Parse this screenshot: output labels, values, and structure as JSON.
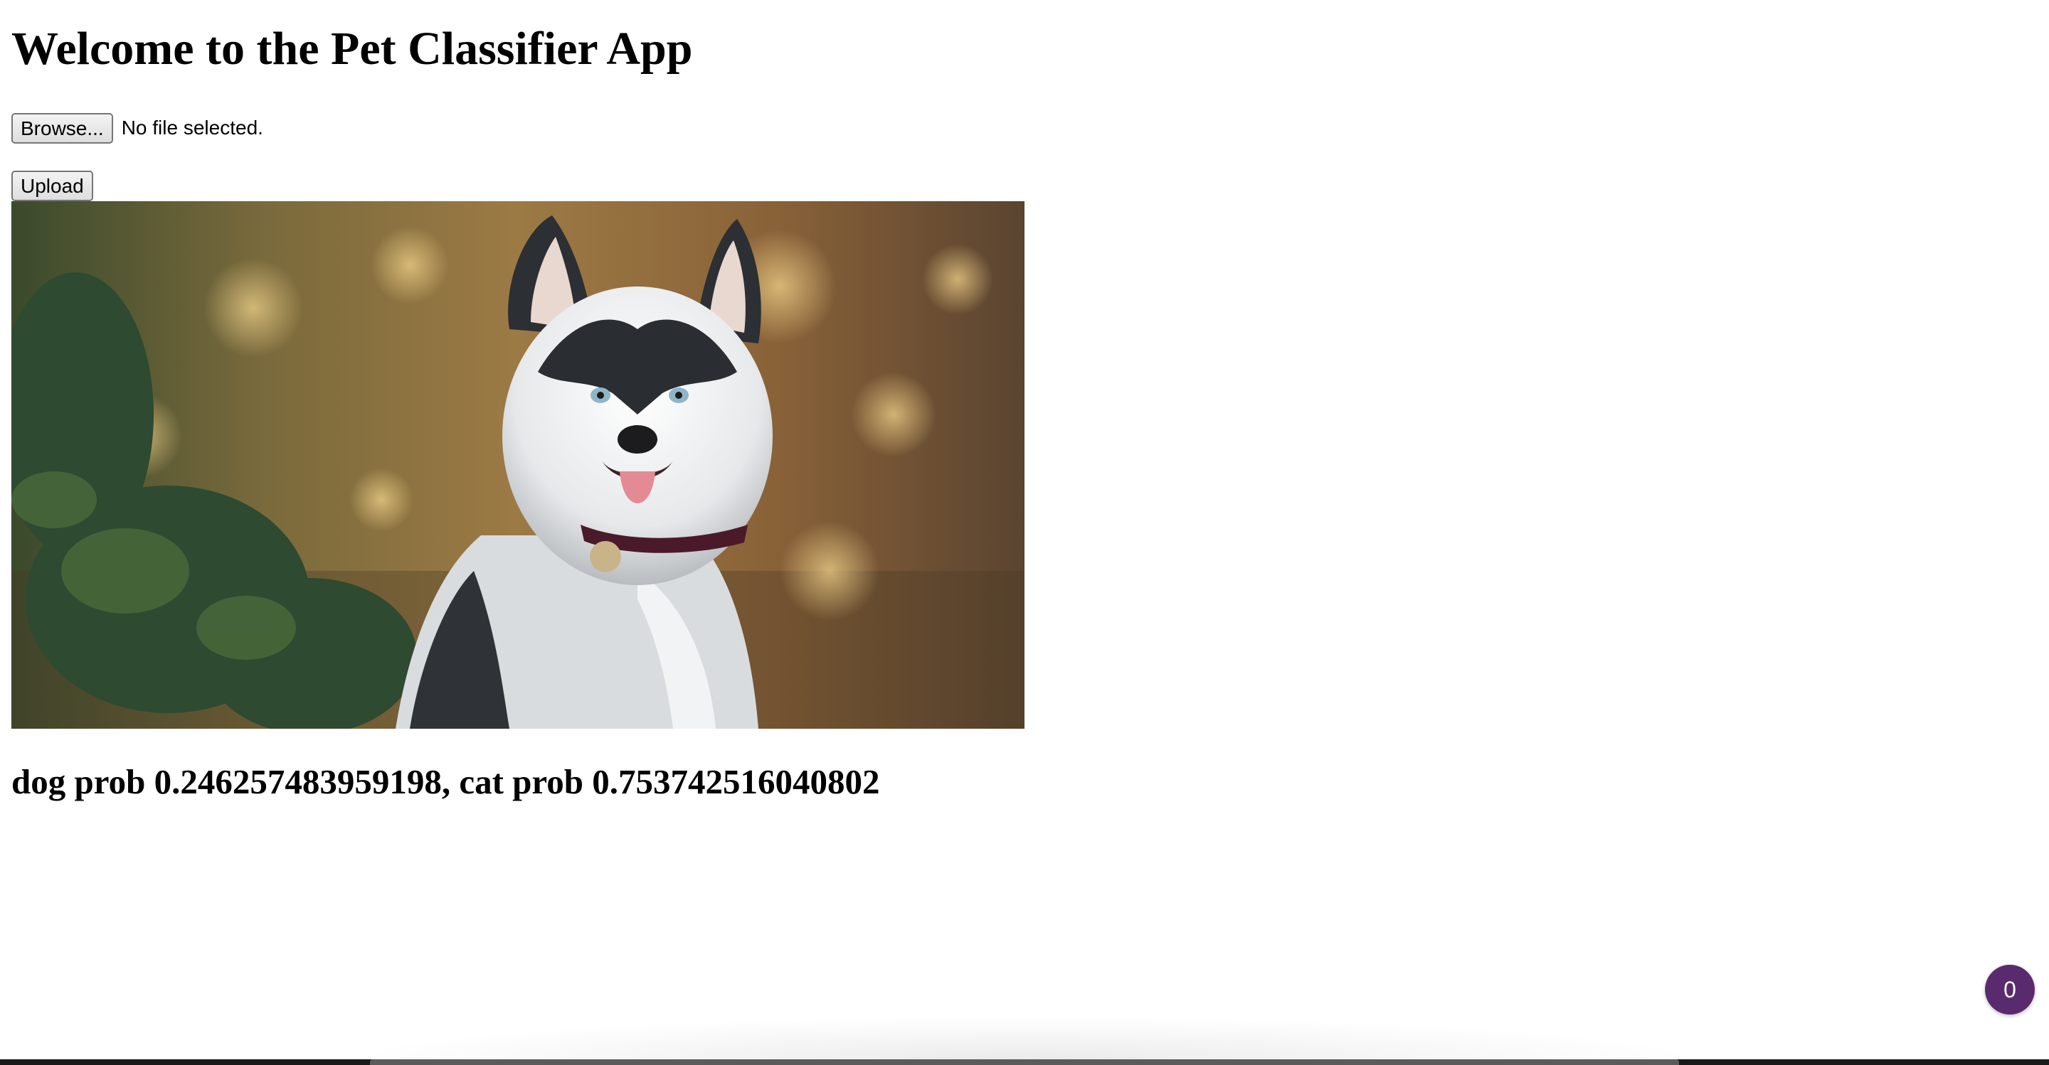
{
  "header": {
    "title": "Welcome to the Pet Classifier App"
  },
  "upload_form": {
    "browse_label": "Browse...",
    "file_status": "No file selected.",
    "upload_label": "Upload"
  },
  "preview": {
    "subject": "husky dog photo"
  },
  "result": {
    "text": "dog prob 0.246257483959198, cat prob 0.753742516040802"
  },
  "badge": {
    "count": "0",
    "color": "#5a2a6e"
  }
}
